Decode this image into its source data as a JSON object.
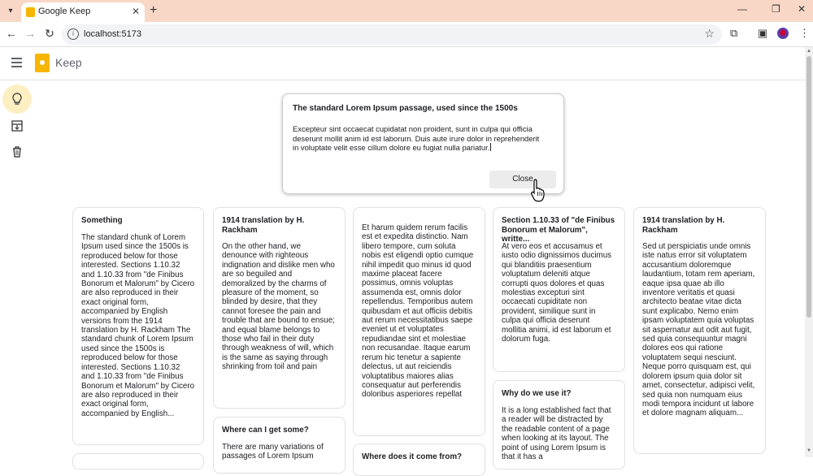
{
  "browser": {
    "tab_title": "Google Keep",
    "url": "localhost:5173"
  },
  "app": {
    "title": "Keep",
    "brand_color": "#f7b500",
    "active_nav_color": "#feefc3"
  },
  "sidebar": {
    "items": [
      {
        "icon": "lightbulb-icon",
        "active": true
      },
      {
        "icon": "archive-icon",
        "active": false
      },
      {
        "icon": "trash-icon",
        "active": false
      }
    ]
  },
  "editor": {
    "title": "The standard Lorem Ipsum passage, used since the 1500s",
    "body": "Excepteur sint occaecat cupidatat non proident, sunt in culpa qui officia deserunt mollit anim id est laborum. Duis aute irure dolor in reprehenderit in voluptate velit esse cillum dolore eu fugiat nulla pariatur.",
    "close_label": "Close"
  },
  "notes": [
    {
      "title": "Something",
      "body": "The standard chunk of Lorem Ipsum used since the 1500s is reproduced below for those interested. Sections 1.10.32 and 1.10.33 from \"de Finibus Bonorum et Malorum\" by Cicero are also reproduced in their exact original form, accompanied by English versions from the 1914 translation by H. Rackham The standard chunk of Lorem Ipsum used since the 1500s is reproduced below for those interested. Sections 1.10.32 and 1.10.33 from \"de Finibus Bonorum et Malorum\" by Cicero are also reproduced in their exact original form, accompanied by English..."
    },
    {
      "title": "1914 translation by H. Rackham",
      "body": "On the other hand, we denounce with righteous indignation and dislike men who are so beguiled and demoralized by the charms of pleasure of the moment, so blinded by desire, that they cannot foresee the pain and trouble that are bound to ensue; and equal blame belongs to those who fail in their duty through weakness of will, which is the same as saying through shrinking from toil and pain"
    },
    {
      "title": "Where can I get some?",
      "body": "There are many variations of passages of Lorem Ipsum"
    },
    {
      "title": "",
      "body": "Et harum quidem rerum facilis est et expedita distinctio. Nam libero tempore, cum soluta nobis est eligendi optio cumque nihil impedit quo minus id quod maxime placeat facere possimus, omnis voluptas assumenda est, omnis dolor repellendus. Temporibus autem quibusdam et aut officiis debitis aut rerum necessitatibus saepe eveniet ut et voluptates repudiandae sint et molestiae non recusandae. Itaque earum rerum hic tenetur a sapiente delectus, ut aut reiciendis voluptatibus maiores alias consequatur aut perferendis doloribus asperiores repellat"
    },
    {
      "title": "Where does it come from?",
      "body": ""
    },
    {
      "title": "Section 1.10.33 of \"de Finibus Bonorum et Malorum\", writte...",
      "body": "At vero eos et accusamus et iusto odio dignissimos ducimus qui blanditiis praesentium voluptatum deleniti atque corrupti quos dolores et quas molestias excepturi sint occaecati cupiditate non provident, similique sunt in culpa qui officia deserunt mollitia animi, id est laborum et dolorum fuga."
    },
    {
      "title": "Why do we use it?",
      "body": "It is a long established fact that a reader will be distracted by the readable content of a page when looking at its layout. The point of using Lorem Ipsum is that it has a"
    },
    {
      "title": "1914 translation by H. Rackham",
      "body": "Sed ut perspiciatis unde omnis iste natus error sit voluptatem accusantium doloremque laudantium, totam rem aperiam, eaque ipsa quae ab illo inventore veritatis et quasi architecto beatae vitae dicta sunt explicabo. Nemo enim ipsam voluptatem quia voluptas sit aspernatur aut odit aut fugit, sed quia consequuntur magni dolores eos qui ratione voluptatem sequi nesciunt. Neque porro quisquam est, qui dolorem ipsum quia dolor sit amet, consectetur, adipisci velit, sed quia non numquam eius modi tempora incidunt ut labore et dolore magnam aliquam..."
    }
  ]
}
